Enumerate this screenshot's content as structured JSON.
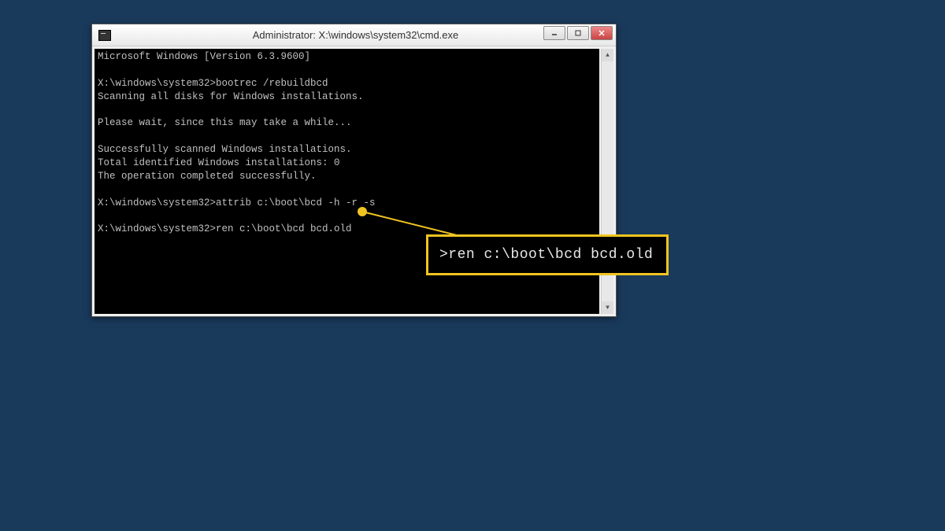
{
  "window": {
    "title": "Administrator: X:\\windows\\system32\\cmd.exe"
  },
  "terminal": {
    "lines": [
      "Microsoft Windows [Version 6.3.9600]",
      "",
      "X:\\windows\\system32>bootrec /rebuildbcd",
      "Scanning all disks for Windows installations.",
      "",
      "Please wait, since this may take a while...",
      "",
      "Successfully scanned Windows installations.",
      "Total identified Windows installations: 0",
      "The operation completed successfully.",
      "",
      "X:\\windows\\system32>attrib c:\\boot\\bcd -h -r -s",
      "",
      "X:\\windows\\system32>ren c:\\boot\\bcd bcd.old"
    ]
  },
  "callout": {
    "text": ">ren c:\\boot\\bcd bcd.old"
  }
}
